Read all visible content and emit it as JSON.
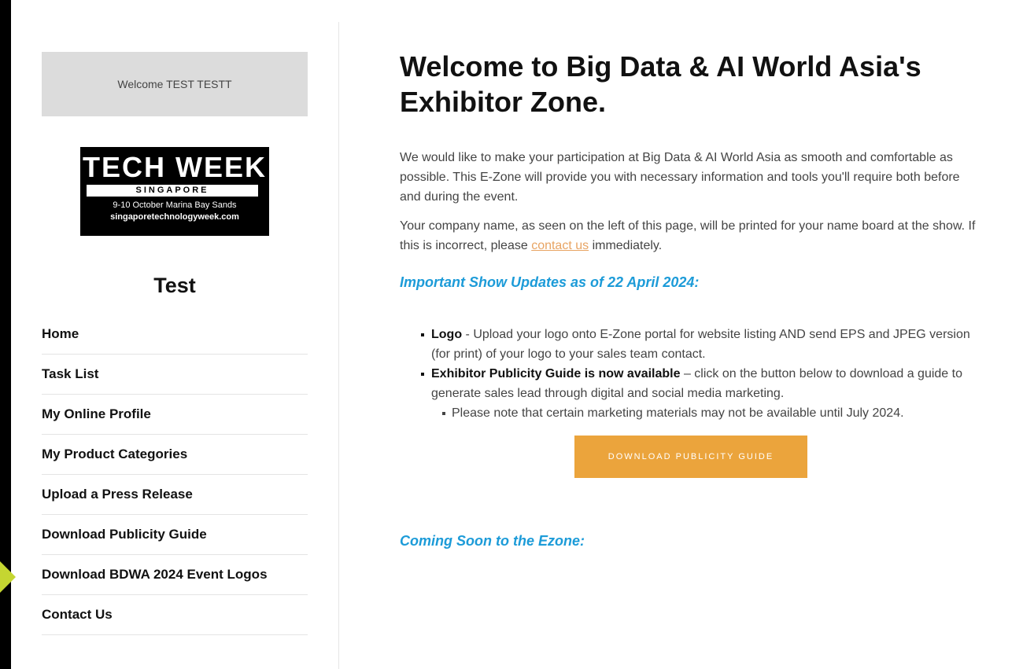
{
  "sidebar": {
    "welcome": "Welcome TEST TESTT",
    "logo": {
      "main": "TECH WEEK",
      "bar": "SINGAPORE",
      "date": "9-10 October Marina Bay Sands",
      "url": "singaporetechnologyweek.com"
    },
    "company_name": "Test",
    "nav": [
      {
        "label": "Home"
      },
      {
        "label": "Task List"
      },
      {
        "label": "My Online Profile"
      },
      {
        "label": "My Product Categories"
      },
      {
        "label": "Upload a Press Release"
      },
      {
        "label": "Download Publicity Guide"
      },
      {
        "label": "Download BDWA 2024 Event Logos"
      },
      {
        "label": "Contact Us"
      }
    ]
  },
  "main": {
    "title": "Welcome to Big Data & AI World Asia's Exhibitor Zone.",
    "intro": "We would like to make your participation at Big Data & AI World Asia as smooth and comfortable as possible. This E-Zone will provide you with necessary information and tools you'll require both before and during the event.",
    "intro2_before": "Your company name, as seen on the left of this page, will be printed for your name board at the show. If this is incorrect, please ",
    "intro2_link": "contact us",
    "intro2_after": " immediately.",
    "updates_heading": "Important Show Updates as of 22 April 2024:",
    "updates": [
      {
        "bold": "Logo",
        "text": " - Upload your logo onto E-Zone portal for website listing AND send EPS and JPEG version (for print) of your logo to your sales team contact."
      },
      {
        "bold": "Exhibitor Publicity Guide is now available",
        "text": " – click on the button below to download a guide to generate sales lead through digital and social media marketing.",
        "sub": "Please note that certain marketing materials may not be available until July 2024."
      }
    ],
    "download_button": "DOWNLOAD PUBLICITY GUIDE",
    "coming_soon_heading": "Coming Soon to the Ezone:"
  },
  "colors": {
    "link": "#e8a463",
    "heading_blue": "#1c9bd8",
    "button": "#eba43c",
    "pointer": "#c5d631"
  }
}
